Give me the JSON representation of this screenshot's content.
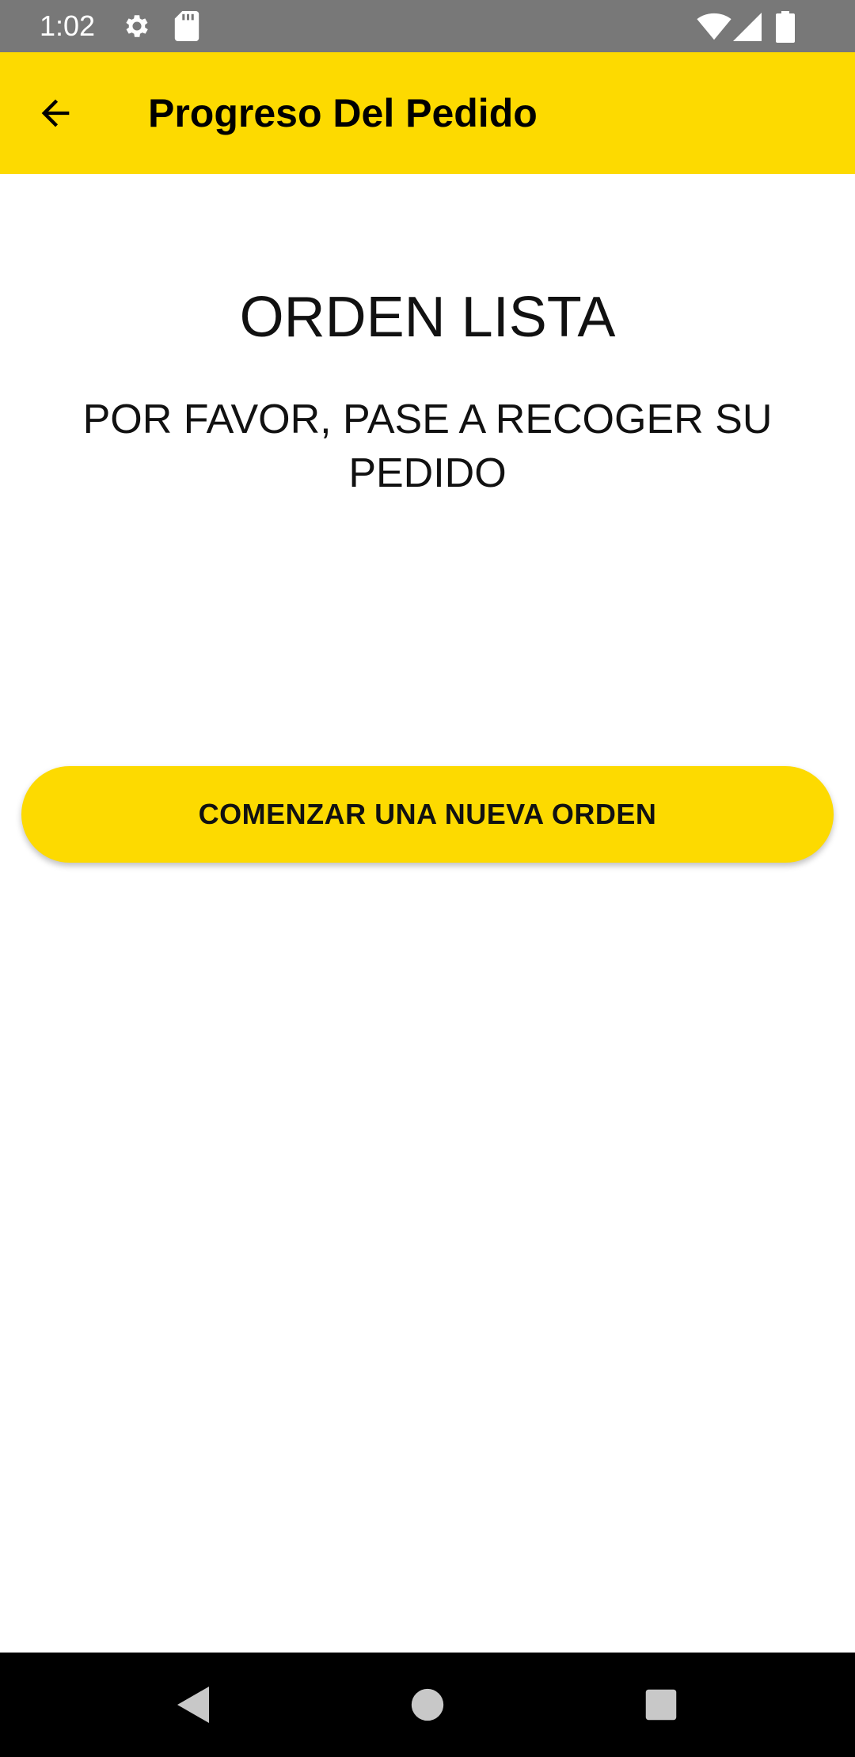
{
  "status_bar": {
    "time": "1:02",
    "icons": [
      "gear-icon",
      "sd-card-icon",
      "wifi-icon",
      "signal-icon",
      "battery-icon"
    ]
  },
  "app_bar": {
    "title": "Progreso Del Pedido",
    "back_icon": "arrow-back-icon",
    "background_color": "#FDDA00"
  },
  "main": {
    "heading": "ORDEN LISTA",
    "subheading": "POR FAVOR, PASE A RECOGER SU PEDIDO",
    "new_order_button": "COMENZAR UNA NUEVA ORDEN"
  },
  "nav_bar": {
    "icons": [
      "nav-back-icon",
      "nav-home-icon",
      "nav-recents-icon"
    ]
  }
}
